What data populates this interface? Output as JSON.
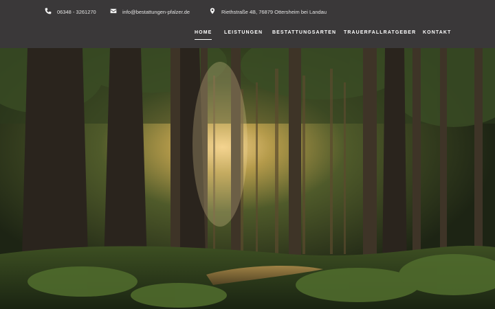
{
  "contact": {
    "phone": "06348 - 3261270",
    "email": "info@bestattungen-pfalzer.de",
    "address": "Riethstraße 4B, 76879 Ottersheim bei Landau"
  },
  "nav": {
    "items": [
      {
        "label": "HOME",
        "active": true
      },
      {
        "label": "LEISTUNGEN",
        "active": false
      },
      {
        "label": "BESTATTUNGSARTEN",
        "active": false
      },
      {
        "label": "TRAUERFALLRATGEBER",
        "active": false
      },
      {
        "label": "KONTAKT",
        "active": false
      }
    ]
  },
  "hero": {
    "image": "forest-photo"
  },
  "colors": {
    "header_bg": "#3a3839",
    "text": "#ffffff"
  }
}
